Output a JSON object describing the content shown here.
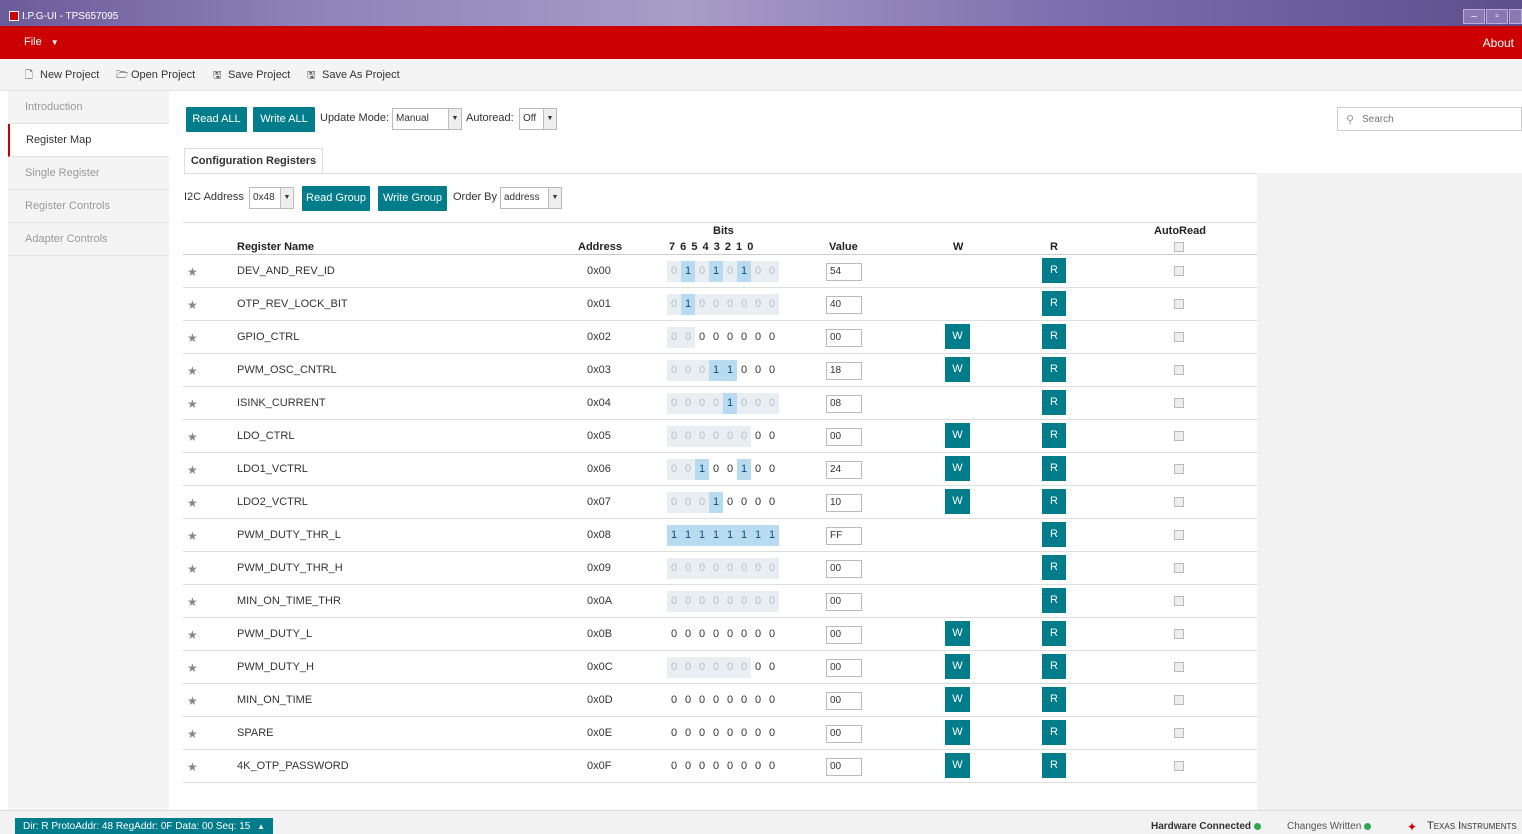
{
  "window": {
    "title": "I.P.G-UI - TPS657095"
  },
  "menu": {
    "file": "File",
    "about": "About"
  },
  "toolbar": [
    {
      "label": "New Project",
      "icon": "file-icon"
    },
    {
      "label": "Open Project",
      "icon": "folder-open-icon"
    },
    {
      "label": "Save Project",
      "icon": "save-icon"
    },
    {
      "label": "Save As Project",
      "icon": "save-as-icon"
    }
  ],
  "sidebar": [
    {
      "label": "Introduction"
    },
    {
      "label": "Register Map"
    },
    {
      "label": "Single Register"
    },
    {
      "label": "Register Controls"
    },
    {
      "label": "Adapter Controls"
    }
  ],
  "controls": {
    "read_all": "Read ALL",
    "write_all": "Write ALL",
    "update_mode_label": "Update Mode:",
    "update_mode_value": "Manual",
    "autoread_label": "Autoread:",
    "autoread_value": "Off",
    "search_placeholder": "Search"
  },
  "tab": {
    "label": "Configuration Registers"
  },
  "group": {
    "i2c_label": "I2C Address",
    "i2c_value": "0x48",
    "read_group": "Read Group",
    "write_group": "Write Group",
    "order_label": "Order By",
    "order_value": "address"
  },
  "table": {
    "headers": {
      "name": "Register Name",
      "address": "Address",
      "bits": "Bits",
      "bit_numbers": "7 6 5 4 3 2 1 0",
      "value": "Value",
      "w": "W",
      "r": "R",
      "autoread": "AutoRead"
    },
    "rows": [
      {
        "name": "DEV_AND_REV_ID",
        "address": "0x00",
        "value": "54",
        "bits": "01010100",
        "rw": "rrrrrrrr",
        "writable": false
      },
      {
        "name": "OTP_REV_LOCK_BIT",
        "address": "0x01",
        "value": "40",
        "bits": "01000000",
        "rw": "rrrrrrrr",
        "writable": false
      },
      {
        "name": "GPIO_CTRL",
        "address": "0x02",
        "value": "00",
        "bits": "00000000",
        "rw": "rrwwwwww",
        "writable": true
      },
      {
        "name": "PWM_OSC_CNTRL",
        "address": "0x03",
        "value": "18",
        "bits": "00011000",
        "rw": "rrrwwwww",
        "writable": true
      },
      {
        "name": "ISINK_CURRENT",
        "address": "0x04",
        "value": "08",
        "bits": "00001000",
        "rw": "rrrrrrrr",
        "writable": false
      },
      {
        "name": "LDO_CTRL",
        "address": "0x05",
        "value": "00",
        "bits": "00000000",
        "rw": "rrrrrrww",
        "writable": true
      },
      {
        "name": "LDO1_VCTRL",
        "address": "0x06",
        "value": "24",
        "bits": "00100100",
        "rw": "rrwwwwww",
        "writable": true
      },
      {
        "name": "LDO2_VCTRL",
        "address": "0x07",
        "value": "10",
        "bits": "00010000",
        "rw": "rrrwwwww",
        "writable": true
      },
      {
        "name": "PWM_DUTY_THR_L",
        "address": "0x08",
        "value": "FF",
        "bits": "11111111",
        "rw": "rrrrrrrr",
        "writable": false
      },
      {
        "name": "PWM_DUTY_THR_H",
        "address": "0x09",
        "value": "00",
        "bits": "00000000",
        "rw": "rrrrrrrr",
        "writable": false
      },
      {
        "name": "MIN_ON_TIME_THR",
        "address": "0x0A",
        "value": "00",
        "bits": "00000000",
        "rw": "rrrrrrrr",
        "writable": false
      },
      {
        "name": "PWM_DUTY_L",
        "address": "0x0B",
        "value": "00",
        "bits": "00000000",
        "rw": "wwwwwwww",
        "writable": true
      },
      {
        "name": "PWM_DUTY_H",
        "address": "0x0C",
        "value": "00",
        "bits": "00000000",
        "rw": "rrrrrrww",
        "writable": true
      },
      {
        "name": "MIN_ON_TIME",
        "address": "0x0D",
        "value": "00",
        "bits": "00000000",
        "rw": "wwwwwwww",
        "writable": true
      },
      {
        "name": "SPARE",
        "address": "0x0E",
        "value": "00",
        "bits": "00000000",
        "rw": "wwwwwwww",
        "writable": true
      },
      {
        "name": "4K_OTP_PASSWORD",
        "address": "0x0F",
        "value": "00",
        "bits": "00000000",
        "rw": "wwwwwwww",
        "writable": true
      }
    ]
  },
  "status": {
    "info": "Dir: R ProtoAddr: 48 RegAddr: 0F Data: 00 Seq: 15",
    "hardware": "Hardware Connected",
    "changes": "Changes Written",
    "brand": "Texas Instruments",
    "ok_color": "#2fa84f"
  },
  "colors": {
    "accent": "#007c8a",
    "menu": "#cc0000"
  }
}
